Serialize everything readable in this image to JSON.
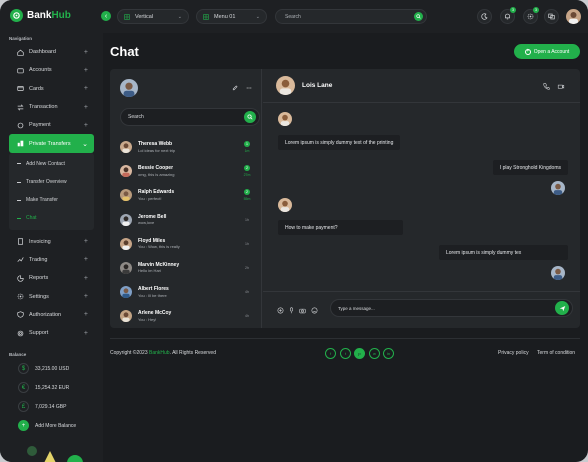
{
  "brand": {
    "name_prefix": "Bank",
    "name_suffix": "Hub"
  },
  "colors": {
    "accent": "#22b04b",
    "bg": "#1a1c1f",
    "panel": "#25282b"
  },
  "sidebar": {
    "nav_label": "Navigation",
    "items": [
      {
        "label": "Dashboard",
        "icon": "home-icon"
      },
      {
        "label": "Accounts",
        "icon": "wallet-icon"
      },
      {
        "label": "Cards",
        "icon": "card-icon"
      },
      {
        "label": "Transaction",
        "icon": "transfer-icon"
      },
      {
        "label": "Payment",
        "icon": "payment-icon"
      },
      {
        "label": "Private Transfers",
        "icon": "bank-icon",
        "active": true
      }
    ],
    "sub_items": [
      {
        "label": "Add New Contact"
      },
      {
        "label": "Transfer Overview"
      },
      {
        "label": "Make Transfer"
      },
      {
        "label": "Chat",
        "current": true
      }
    ],
    "items_after": [
      {
        "label": "Invoicing",
        "icon": "invoice-icon"
      },
      {
        "label": "Trading",
        "icon": "trading-icon"
      },
      {
        "label": "Reports",
        "icon": "report-icon"
      },
      {
        "label": "Settings",
        "icon": "gear-icon"
      },
      {
        "label": "Authorization",
        "icon": "shield-icon"
      },
      {
        "label": "Support",
        "icon": "support-icon"
      }
    ],
    "balance_label": "Balance",
    "balances": [
      {
        "symbol": "$",
        "value": "33,215.00 USD"
      },
      {
        "symbol": "€",
        "value": "15,254.32 EUR"
      },
      {
        "symbol": "£",
        "value": "7,029.14 GBP"
      }
    ],
    "add_balance": "Add More Balance"
  },
  "topbar": {
    "layout_select": "Vertical",
    "menu_select": "Menu 01",
    "search_placeholder": "Search",
    "notification_count": "3",
    "settings_count": "3"
  },
  "page": {
    "title": "Chat",
    "open_account": "Open a Account"
  },
  "contacts": {
    "search_value": "Search",
    "list": [
      {
        "name": "Theresa Webb",
        "msg": "Lol ideas for next trip",
        "badge": "1",
        "time": "1m",
        "time_green": true
      },
      {
        "name": "Bessie Cooper",
        "msg": "omg, this is amazing",
        "badge": "2",
        "time": "27m",
        "time_green": true
      },
      {
        "name": "Ralph Edwards",
        "msg": "You : perfect!",
        "badge": "2",
        "time": "55m",
        "time_green": true
      },
      {
        "name": "Jerome Bell",
        "msg": "wow,love",
        "badge": "",
        "time": "1h",
        "time_green": false
      },
      {
        "name": "Floyd Miles",
        "msg": "You : Wow, this is really",
        "badge": "",
        "time": "1h",
        "time_green": false
      },
      {
        "name": "Marvin McKinney",
        "msg": "Hello im Hari",
        "badge": "",
        "time": "2h",
        "time_green": false
      },
      {
        "name": "Albert Flores",
        "msg": "You : Ill be there",
        "badge": "",
        "time": "4h",
        "time_green": false
      },
      {
        "name": "Arlene McCoy",
        "msg": "You : Hey!",
        "badge": "",
        "time": "4h",
        "time_green": false
      }
    ]
  },
  "conversation": {
    "name": "Lois Lane",
    "messages": [
      {
        "text": "Lorem ipsum is simply dummy text of the printing",
        "side": "left"
      },
      {
        "text": "I play Stronghold Kingdoms",
        "side": "right"
      },
      {
        "text": "How to make payment?",
        "side": "left"
      },
      {
        "text": "Lorem ipsum is simply dummy tex",
        "side": "right"
      }
    ],
    "composer_placeholder": "Type a message..."
  },
  "footer": {
    "copyright_prefix": "Copyright ©2023 ",
    "copyright_brand": "BankHub",
    "copyright_suffix": ". All Rights Reserved",
    "social": [
      "f",
      "t",
      "p",
      "w",
      "in"
    ],
    "privacy": "Privacy policy",
    "terms": "Term of condition"
  }
}
